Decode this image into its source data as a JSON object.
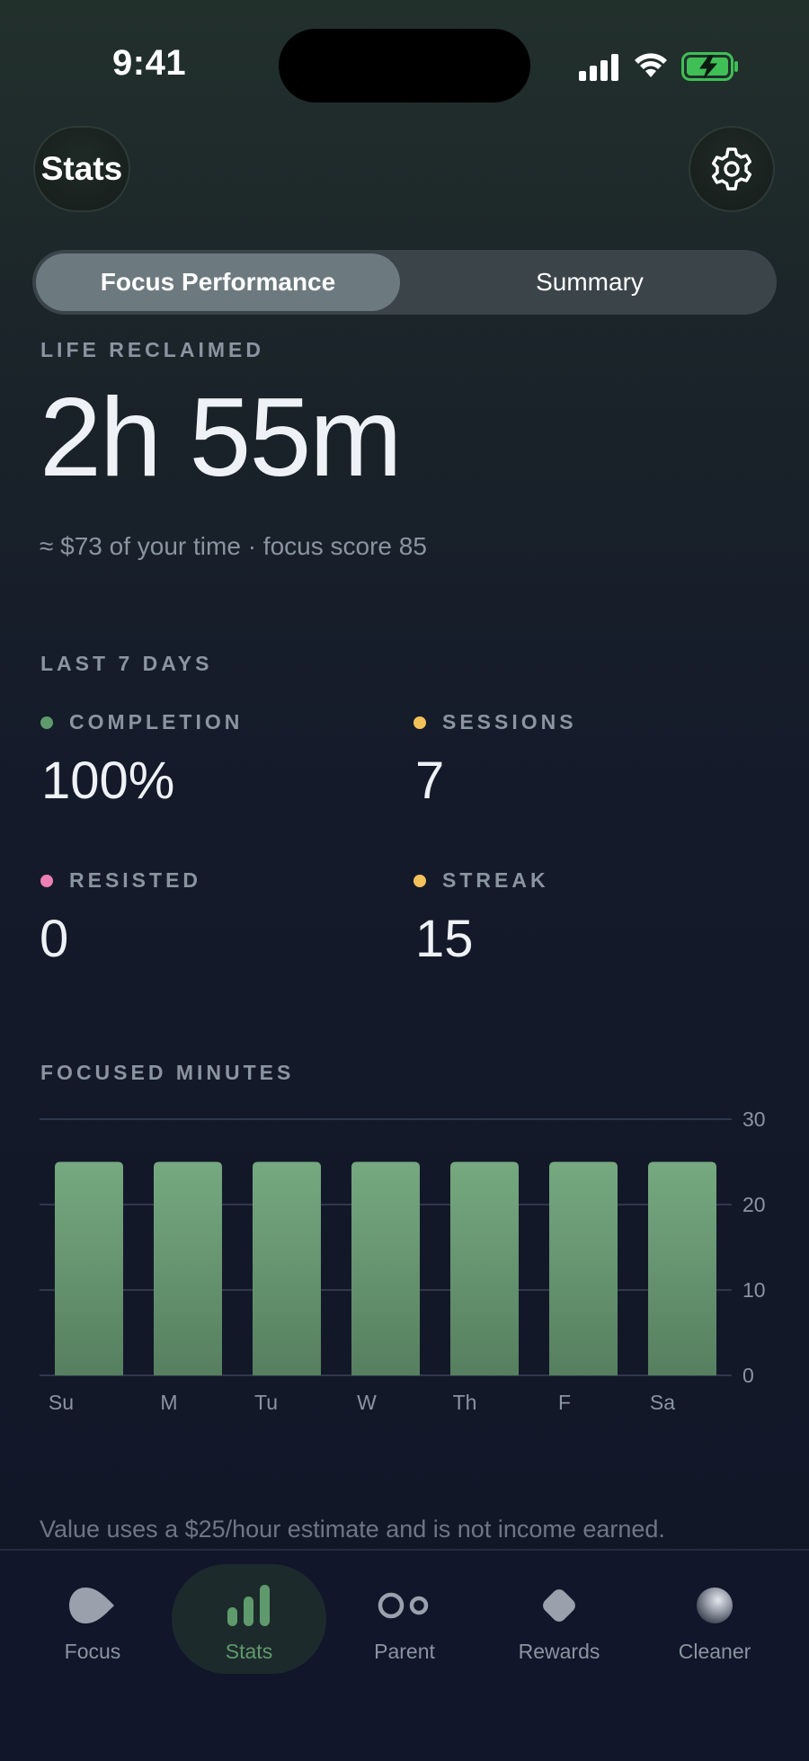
{
  "status_bar": {
    "time": "9:41"
  },
  "header": {
    "title": "Stats"
  },
  "segmented": {
    "tabs": [
      "Focus Performance",
      "Summary"
    ],
    "selected": "Focus Performance"
  },
  "life_reclaimed": {
    "label": "LIFE RECLAIMED",
    "value": "2h 55m",
    "subtitle": "≈ $73 of your time · focus score 85"
  },
  "last7": {
    "label": "LAST 7 DAYS",
    "metrics": [
      {
        "label": "COMPLETION",
        "value": "100%",
        "color": "#5f9a6c"
      },
      {
        "label": "SESSIONS",
        "value": "7",
        "color": "#f3c15a"
      },
      {
        "label": "RESISTED",
        "value": "0",
        "color": "#ec7fb4"
      },
      {
        "label": "STREAK",
        "value": "15",
        "color": "#f3c15a"
      }
    ]
  },
  "focused_minutes": {
    "label": "FOCUSED MINUTES"
  },
  "chart_data": {
    "type": "bar",
    "categories": [
      "Su",
      "M",
      "Tu",
      "W",
      "Th",
      "F",
      "Sa"
    ],
    "values": [
      25,
      25,
      25,
      25,
      25,
      25,
      25
    ],
    "xlabel": "",
    "ylabel": "",
    "ylim": [
      0,
      30
    ],
    "yticks": [
      0,
      10,
      20,
      30
    ],
    "grid": true,
    "bar_color": "#6a9e74"
  },
  "footnote": "Value uses a $25/hour estimate and is not income earned.",
  "tabbar": {
    "items": [
      {
        "label": "Focus",
        "icon": "focus-icon"
      },
      {
        "label": "Stats",
        "icon": "stats-icon",
        "active": true
      },
      {
        "label": "Parent",
        "icon": "parent-icon"
      },
      {
        "label": "Rewards",
        "icon": "rewards-icon"
      },
      {
        "label": "Cleaner",
        "icon": "cleaner-icon"
      }
    ],
    "active_color": "#5f9a6c"
  }
}
